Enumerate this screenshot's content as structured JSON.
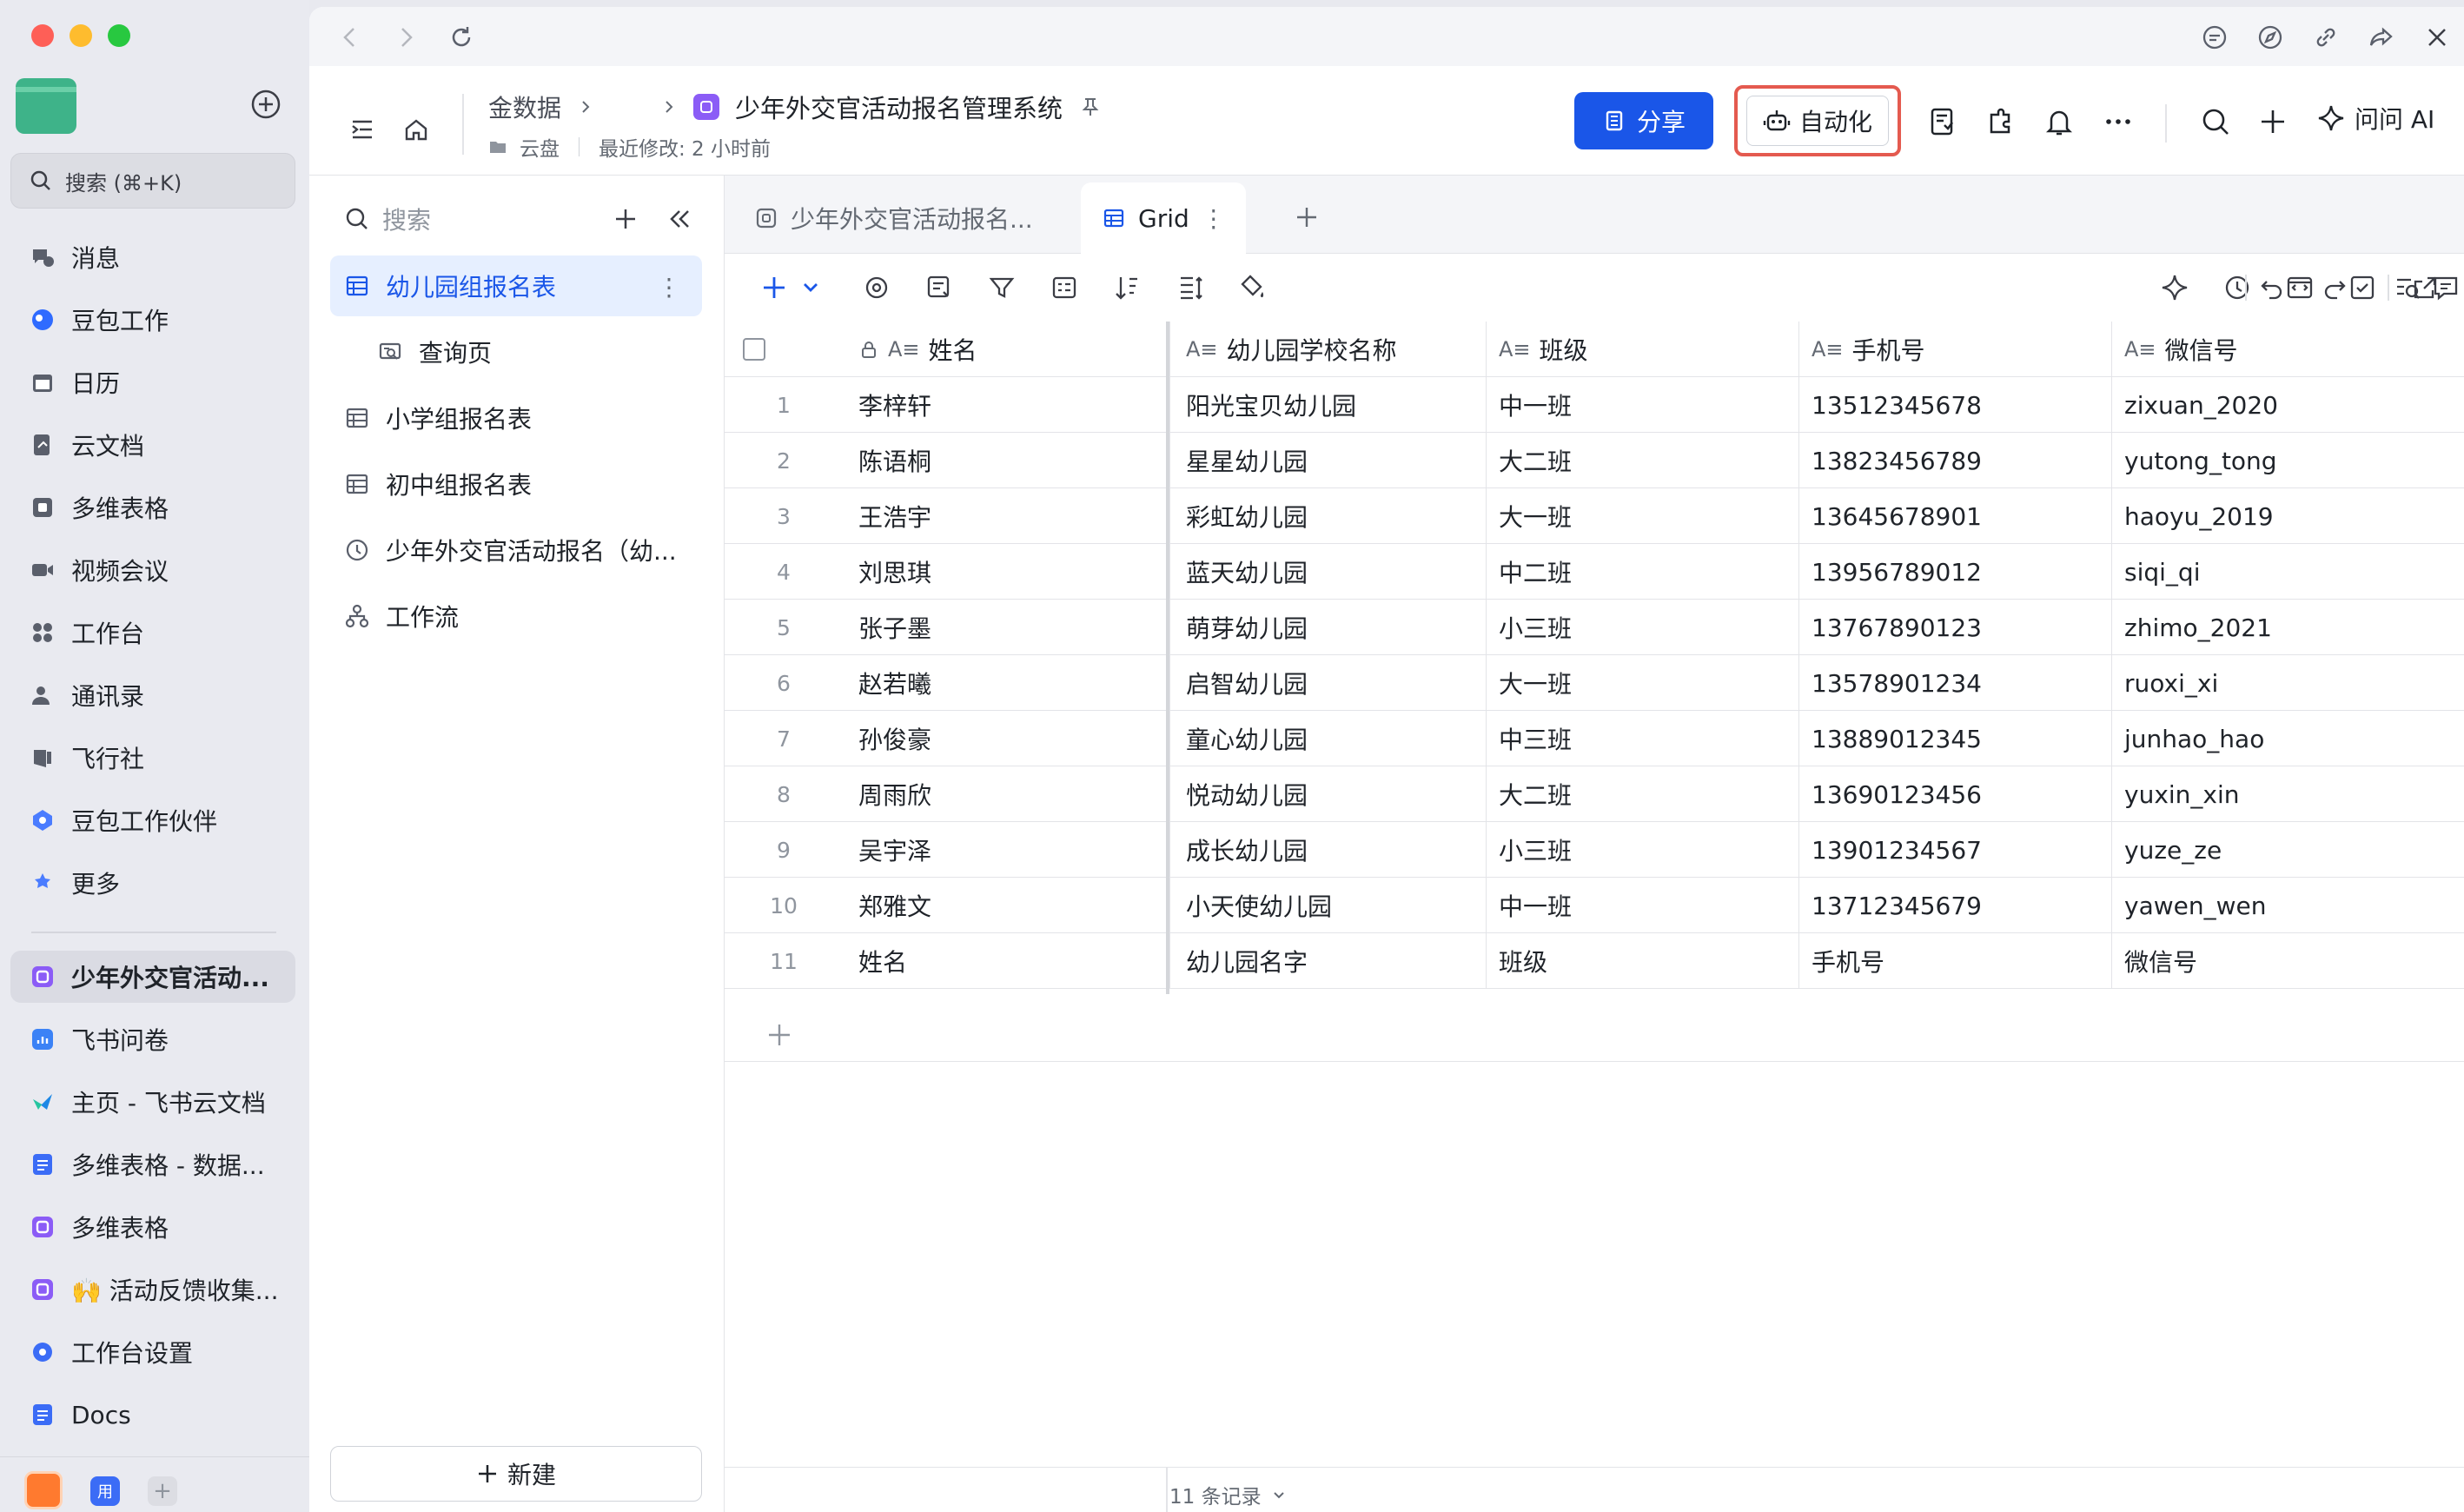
{
  "sidebar": {
    "search_placeholder": "搜索 (⌘+K)",
    "nav_items": [
      {
        "label": "消息",
        "icon": "message-icon",
        "color": "#5a5f6b"
      },
      {
        "label": "豆包工作",
        "icon": "doubao-icon",
        "color": "#2f6bff"
      },
      {
        "label": "日历",
        "icon": "calendar-icon",
        "color": "#5a5f6b"
      },
      {
        "label": "云文档",
        "icon": "cloud-doc-icon",
        "color": "#5a5f6b"
      },
      {
        "label": "多维表格",
        "icon": "base-icon",
        "color": "#5a5f6b"
      },
      {
        "label": "视频会议",
        "icon": "video-icon",
        "color": "#5a5f6b"
      },
      {
        "label": "工作台",
        "icon": "workplace-icon",
        "color": "#5a5f6b"
      },
      {
        "label": "通讯录",
        "icon": "contacts-icon",
        "color": "#5a5f6b"
      },
      {
        "label": "飞行社",
        "icon": "flight-icon",
        "color": "#5a5f6b"
      },
      {
        "label": "豆包工作伙伴",
        "icon": "partner-icon",
        "color": "#4a7cff"
      },
      {
        "label": "更多",
        "icon": "more-apps-icon",
        "color": "#4a7cff"
      }
    ],
    "recent_items": [
      {
        "label": "少年外交官活动...",
        "icon": "base-app-icon",
        "color": "#8b5cf6",
        "active": true
      },
      {
        "label": "飞书问卷",
        "icon": "survey-icon",
        "color": "#3b82f6"
      },
      {
        "label": "主页 - 飞书云文档",
        "icon": "lark-icon",
        "color": "#1e88e5"
      },
      {
        "label": "多维表格 - 数据...",
        "icon": "doc-icon",
        "color": "#3b6cf6"
      },
      {
        "label": "多维表格",
        "icon": "base-app-icon",
        "color": "#8b5cf6"
      },
      {
        "label": "🙌 活动反馈收集...",
        "icon": "base-app-icon",
        "color": "#8b5cf6"
      },
      {
        "label": "工作台设置",
        "icon": "gear-icon",
        "color": "#3b6cf6"
      },
      {
        "label": "Docs",
        "icon": "doc-icon",
        "color": "#3b6cf6"
      }
    ],
    "bottom_badge": "用"
  },
  "header": {
    "breadcrumb_root": "金数据",
    "breadcrumb_mid": "",
    "title": "少年外交官活动报名管理系统",
    "location": "云盘",
    "last_modified": "最近修改: 2 小时前",
    "share_label": "分享",
    "automation_label": "自动化",
    "ask_ai_label": "问问 AI"
  },
  "tables_panel": {
    "search_placeholder": "搜索",
    "items": [
      {
        "label": "幼儿园组报名表",
        "icon": "table-icon",
        "active": true
      },
      {
        "label": "查询页",
        "icon": "query-page-icon",
        "sub": true
      },
      {
        "label": "小学组报名表",
        "icon": "table-icon"
      },
      {
        "label": "初中组报名表",
        "icon": "table-icon"
      },
      {
        "label": "少年外交官活动报名（幼...",
        "icon": "clock-icon"
      },
      {
        "label": "工作流",
        "icon": "workflow-icon"
      }
    ],
    "new_label": "新建"
  },
  "tabs": {
    "form_tab": "少年外交官活动报名...",
    "grid_tab": "Grid"
  },
  "grid": {
    "columns": [
      "姓名",
      "幼儿园学校名称",
      "班级",
      "手机号",
      "微信号"
    ],
    "rows": [
      {
        "no": "1",
        "name": "李梓轩",
        "kg": "阳光宝贝幼儿园",
        "cls": "中一班",
        "phone": "13512345678",
        "wechat": "zixuan_2020"
      },
      {
        "no": "2",
        "name": "陈语桐",
        "kg": "星星幼儿园",
        "cls": "大二班",
        "phone": "13823456789",
        "wechat": "yutong_tong"
      },
      {
        "no": "3",
        "name": "王浩宇",
        "kg": "彩虹幼儿园",
        "cls": "大一班",
        "phone": "13645678901",
        "wechat": "haoyu_2019"
      },
      {
        "no": "4",
        "name": "刘思琪",
        "kg": "蓝天幼儿园",
        "cls": "中二班",
        "phone": "13956789012",
        "wechat": "siqi_qi"
      },
      {
        "no": "5",
        "name": "张子墨",
        "kg": "萌芽幼儿园",
        "cls": "小三班",
        "phone": "13767890123",
        "wechat": "zhimo_2021"
      },
      {
        "no": "6",
        "name": "赵若曦",
        "kg": "启智幼儿园",
        "cls": "大一班",
        "phone": "13578901234",
        "wechat": "ruoxi_xi"
      },
      {
        "no": "7",
        "name": "孙俊豪",
        "kg": "童心幼儿园",
        "cls": "中三班",
        "phone": "13889012345",
        "wechat": "junhao_hao"
      },
      {
        "no": "8",
        "name": "周雨欣",
        "kg": "悦动幼儿园",
        "cls": "大二班",
        "phone": "13690123456",
        "wechat": "yuxin_xin"
      },
      {
        "no": "9",
        "name": "吴宇泽",
        "kg": "成长幼儿园",
        "cls": "小三班",
        "phone": "13901234567",
        "wechat": "yuze_ze"
      },
      {
        "no": "10",
        "name": "郑雅文",
        "kg": "小天使幼儿园",
        "cls": "中一班",
        "phone": "13712345679",
        "wechat": "yawen_wen"
      },
      {
        "no": "11",
        "name": "姓名",
        "kg": "幼儿园名字",
        "cls": "班级",
        "phone": "手机号",
        "wechat": "微信号"
      }
    ],
    "record_count": "11 条记录"
  },
  "colors": {
    "accent": "#1a56e8",
    "highlight_border": "#e45a4f"
  }
}
